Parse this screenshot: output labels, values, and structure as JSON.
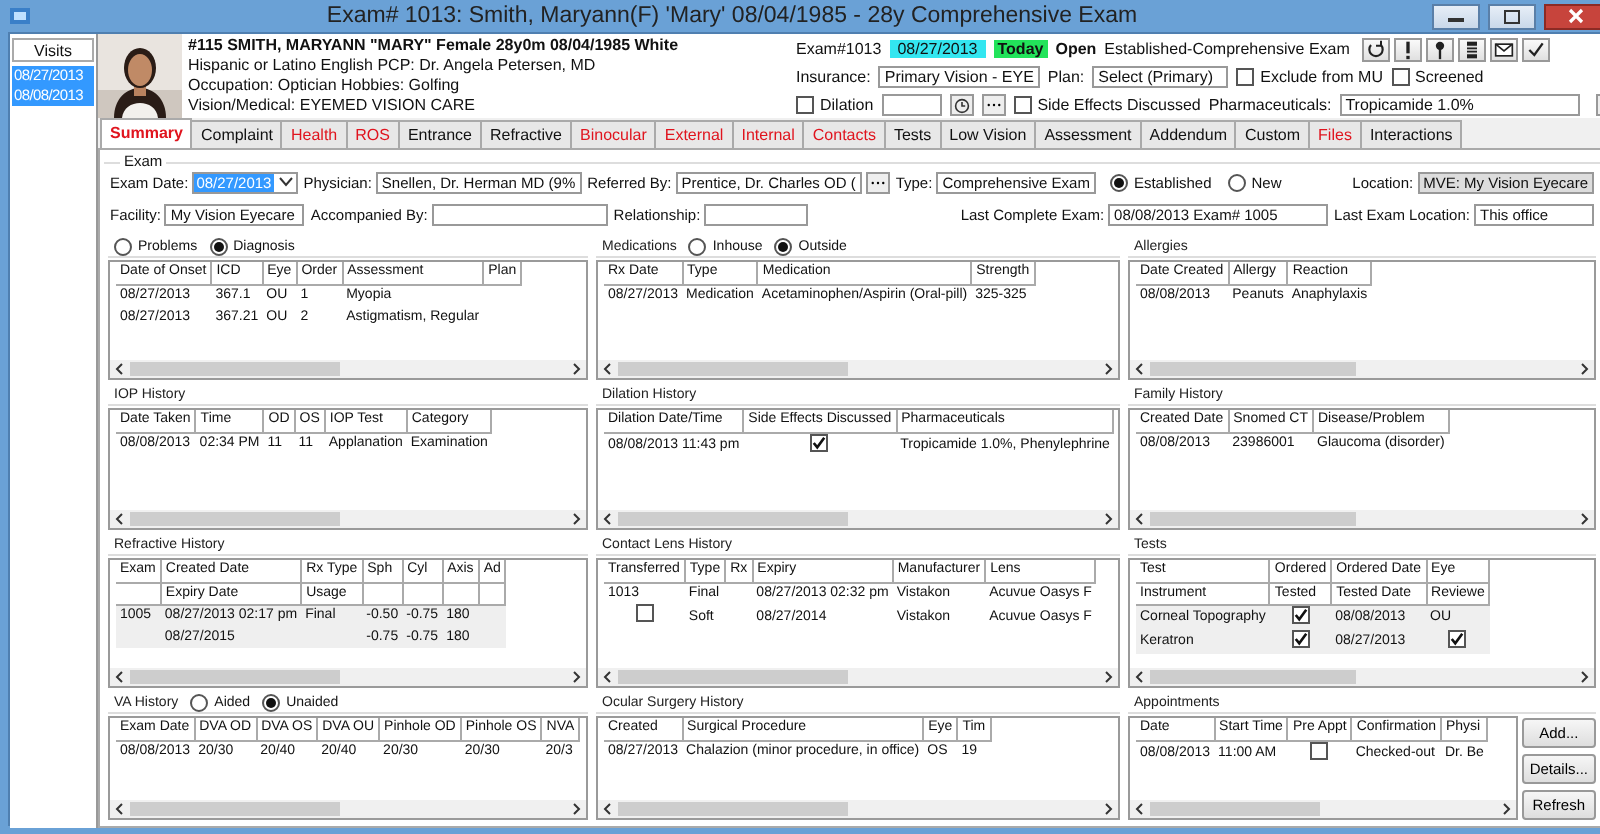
{
  "window": {
    "title": "Exam# 1013:  Smith, Maryann(F) 'Mary' 08/04/1985 - 28y Comprehensive Exam"
  },
  "visits": {
    "label": "Visits",
    "items": [
      {
        "date": "08/27/2013",
        "selected": true
      },
      {
        "date": "08/08/2013",
        "selected": true
      }
    ]
  },
  "patient": {
    "lines": [
      "#115 SMITH, MARYANN  \"MARY\" Female 28y0m 08/04/1985  White",
      "Hispanic or Latino English PCP: Dr. Angela Petersen, MD",
      "Occupation: Optician Hobbies: Golfing",
      "Vision/Medical:  EYEMED VISION CARE"
    ]
  },
  "exam_status": {
    "exam_number": "Exam#1013",
    "date": "08/27/2013",
    "today": "Today",
    "status": "Open",
    "type": "Established-Comprehensive Exam"
  },
  "insurance": {
    "label": "Insurance:",
    "value": "Primary Vision - EYE",
    "plan_label": "Plan:",
    "plan": "Select  (Primary)",
    "options": [
      {
        "label": "Exclude from MU",
        "checked": false
      },
      {
        "label": "Screened",
        "checked": false
      }
    ]
  },
  "dilation": {
    "label": "Dilation",
    "checked": false,
    "side_effects": {
      "label": "Side Effects Discussed",
      "checked": false
    },
    "pharmaceuticals_label": "Pharmaceuticals:",
    "pharmaceuticals": "Tropicamide 1.0%"
  },
  "tabs": [
    {
      "label": "Summary",
      "selected": true,
      "flagged": true
    },
    {
      "label": "Complaint",
      "selected": false,
      "flagged": false
    },
    {
      "label": "Health",
      "selected": false,
      "flagged": true
    },
    {
      "label": "ROS",
      "selected": false,
      "flagged": true
    },
    {
      "label": "Entrance",
      "selected": false,
      "flagged": false
    },
    {
      "label": "Refractive",
      "selected": false,
      "flagged": false
    },
    {
      "label": "Binocular",
      "selected": false,
      "flagged": true
    },
    {
      "label": "External",
      "selected": false,
      "flagged": true
    },
    {
      "label": "Internal",
      "selected": false,
      "flagged": true
    },
    {
      "label": "Contacts",
      "selected": false,
      "flagged": true
    },
    {
      "label": "Tests",
      "selected": false,
      "flagged": false
    },
    {
      "label": "Low Vision",
      "selected": false,
      "flagged": false
    },
    {
      "label": "Assessment",
      "selected": false,
      "flagged": false
    },
    {
      "label": "Addendum",
      "selected": false,
      "flagged": false
    },
    {
      "label": "Custom",
      "selected": false,
      "flagged": false
    },
    {
      "label": "Files",
      "selected": false,
      "flagged": true
    },
    {
      "label": "Interactions",
      "selected": false,
      "flagged": false
    }
  ],
  "exam": {
    "title": "Exam",
    "lines": [
      {
        "fields": [
          {
            "kind": "date",
            "label": "Exam Date:",
            "value": "08/27/2013"
          },
          {
            "kind": "text",
            "label": "Physician:",
            "value": "Snellen, Dr. Herman MD (9%"
          },
          {
            "kind": "browse",
            "label": "Referred By:",
            "value": "Prentice, Dr. Charles OD ("
          },
          {
            "kind": "text",
            "label": "Type:",
            "value": "Comprehensive Exam"
          },
          {
            "kind": "radios",
            "options": [
              {
                "label": "Established",
                "selected": true
              },
              {
                "label": "New",
                "selected": false
              }
            ]
          },
          {
            "kind": "grey",
            "label": "Location:",
            "value": "MVE: My Vision Eyecare"
          }
        ]
      },
      {
        "fields": [
          {
            "kind": "text",
            "label": "Facility:",
            "value": "My Vision Eyecare"
          },
          {
            "kind": "text",
            "label": "Accompanied By:"
          },
          {
            "kind": "text",
            "label": "Relationship:"
          },
          {
            "kind": "text",
            "label": "Last Complete Exam:",
            "value": "08/08/2013 Exam# 1005"
          },
          {
            "kind": "text",
            "label": "Last Exam Location:",
            "value": "This office"
          }
        ]
      }
    ]
  },
  "panels": [
    {
      "options": [
        {
          "label": "Problems",
          "selected": false
        },
        {
          "label": "Diagnosis",
          "selected": true
        }
      ],
      "header_rows": [
        [
          "Date of Onset",
          "ICD",
          "Eye",
          "Order",
          "Assessment",
          "Plan"
        ]
      ],
      "rows": [
        [
          "08/27/2013",
          "367.1",
          "OU",
          "1",
          "Myopia",
          null
        ],
        [
          "08/27/2013",
          "367.21",
          "OU",
          "2",
          "Astigmatism, Regular",
          null
        ]
      ]
    },
    {
      "title": "Medications",
      "options": [
        {
          "label": "Inhouse",
          "selected": false
        },
        {
          "label": "Outside",
          "selected": true
        }
      ],
      "header_rows": [
        [
          "Rx Date",
          "Type",
          "Medication",
          "Strength"
        ]
      ],
      "rows": [
        [
          "08/27/2013",
          "Medication",
          "Acetaminophen/Aspirin (Oral-pill)",
          "325-325"
        ]
      ]
    },
    {
      "title": "Allergies",
      "header_rows": [
        [
          "Date Created",
          "Allergy",
          "Reaction"
        ]
      ],
      "rows": [
        [
          "08/08/2013",
          "Peanuts",
          "Anaphylaxis"
        ]
      ]
    },
    {
      "title": "IOP History",
      "header_rows": [
        [
          "Date Taken",
          "Time",
          "OD",
          "OS",
          "IOP Test",
          "Category"
        ]
      ],
      "rows": [
        [
          "08/08/2013",
          "02:34 PM",
          "11",
          "11",
          "Applanation",
          "Examination"
        ]
      ]
    },
    {
      "title": "Dilation History",
      "header_rows": [
        [
          "Dilation Date/Time",
          "Side Effects Discussed",
          "Pharmaceuticals"
        ]
      ],
      "rows": [
        [
          "08/08/2013 11:43 pm",
          {
            "kind": "check",
            "checked": true
          },
          "Tropicamide 1.0%, Phenylephrine"
        ]
      ]
    },
    {
      "title": "Family History",
      "header_rows": [
        [
          "Created Date",
          "Snomed CT",
          "Disease/Problem"
        ]
      ],
      "rows": [
        [
          "08/08/2013",
          "23986001",
          "Glaucoma (disorder)"
        ]
      ]
    },
    {
      "title": "Refractive History",
      "header_rows": [
        [
          "Exam",
          "Created Date",
          "Rx Type",
          "Sph",
          "Cyl",
          "Axis",
          "Ad"
        ],
        [
          null,
          "Expiry Date",
          "Usage",
          null,
          null,
          null,
          null
        ]
      ],
      "rows": [
        [
          "1005",
          "08/27/2013 02:17 pm",
          "Final",
          "-0.50",
          "-0.75",
          "180",
          null
        ],
        [
          null,
          "08/27/2015",
          null,
          "-0.75",
          "-0.75",
          "180",
          null
        ]
      ]
    },
    {
      "title": "Contact Lens History",
      "header_rows": [
        [
          "Transferred",
          "Type",
          "Rx",
          "Expiry",
          "Manufacturer",
          "Lens"
        ]
      ],
      "rows": [
        [
          "1013",
          "Final",
          null,
          "08/27/2013 02:32 pm",
          "Vistakon",
          "Acuvue Oasys F"
        ],
        [
          {
            "kind": "check",
            "checked": false
          },
          "Soft",
          null,
          "08/27/2014",
          "Vistakon",
          "Acuvue Oasys F"
        ]
      ]
    },
    {
      "title": "Tests",
      "header_rows": [
        [
          "Test",
          "Ordered",
          "Ordered Date",
          "Eye"
        ],
        [
          "Instrument",
          "Tested",
          "Tested Date",
          "Reviewe"
        ]
      ],
      "rows": [
        [
          "Corneal Topography",
          {
            "kind": "check",
            "checked": true
          },
          "08/08/2013",
          "OU"
        ],
        [
          "Keratron",
          {
            "kind": "check",
            "checked": true
          },
          "08/27/2013",
          {
            "kind": "check",
            "checked": true
          }
        ]
      ]
    },
    {
      "title": "VA History",
      "options": [
        {
          "label": "Aided",
          "selected": false
        },
        {
          "label": "Unaided",
          "selected": true
        }
      ],
      "header_rows": [
        [
          "Exam Date",
          "DVA OD",
          "DVA OS",
          "DVA OU",
          "Pinhole OD",
          "Pinhole OS",
          "NVA"
        ]
      ],
      "rows": [
        [
          "08/08/2013",
          "20/30",
          "20/40",
          "20/40",
          "20/30",
          "20/30",
          "20/3"
        ]
      ]
    },
    {
      "title": "Ocular Surgery History",
      "header_rows": [
        [
          "Created",
          "Surgical Procedure",
          "Eye",
          "Tim"
        ]
      ],
      "rows": [
        [
          "08/27/2013",
          "Chalazion (minor procedure, in office)",
          "OS",
          "19"
        ]
      ]
    },
    {
      "title": "Appointments",
      "header_rows": [
        [
          "Date",
          "Start Time",
          "Pre Appt",
          "Confirmation",
          "Physi"
        ]
      ],
      "rows": [
        [
          "08/08/2013",
          "11:00 AM",
          {
            "kind": "check",
            "checked": false
          },
          "Checked-out",
          "Dr. Be"
        ]
      ],
      "buttons": [
        "Add...",
        "Details...",
        "Refresh"
      ]
    }
  ]
}
